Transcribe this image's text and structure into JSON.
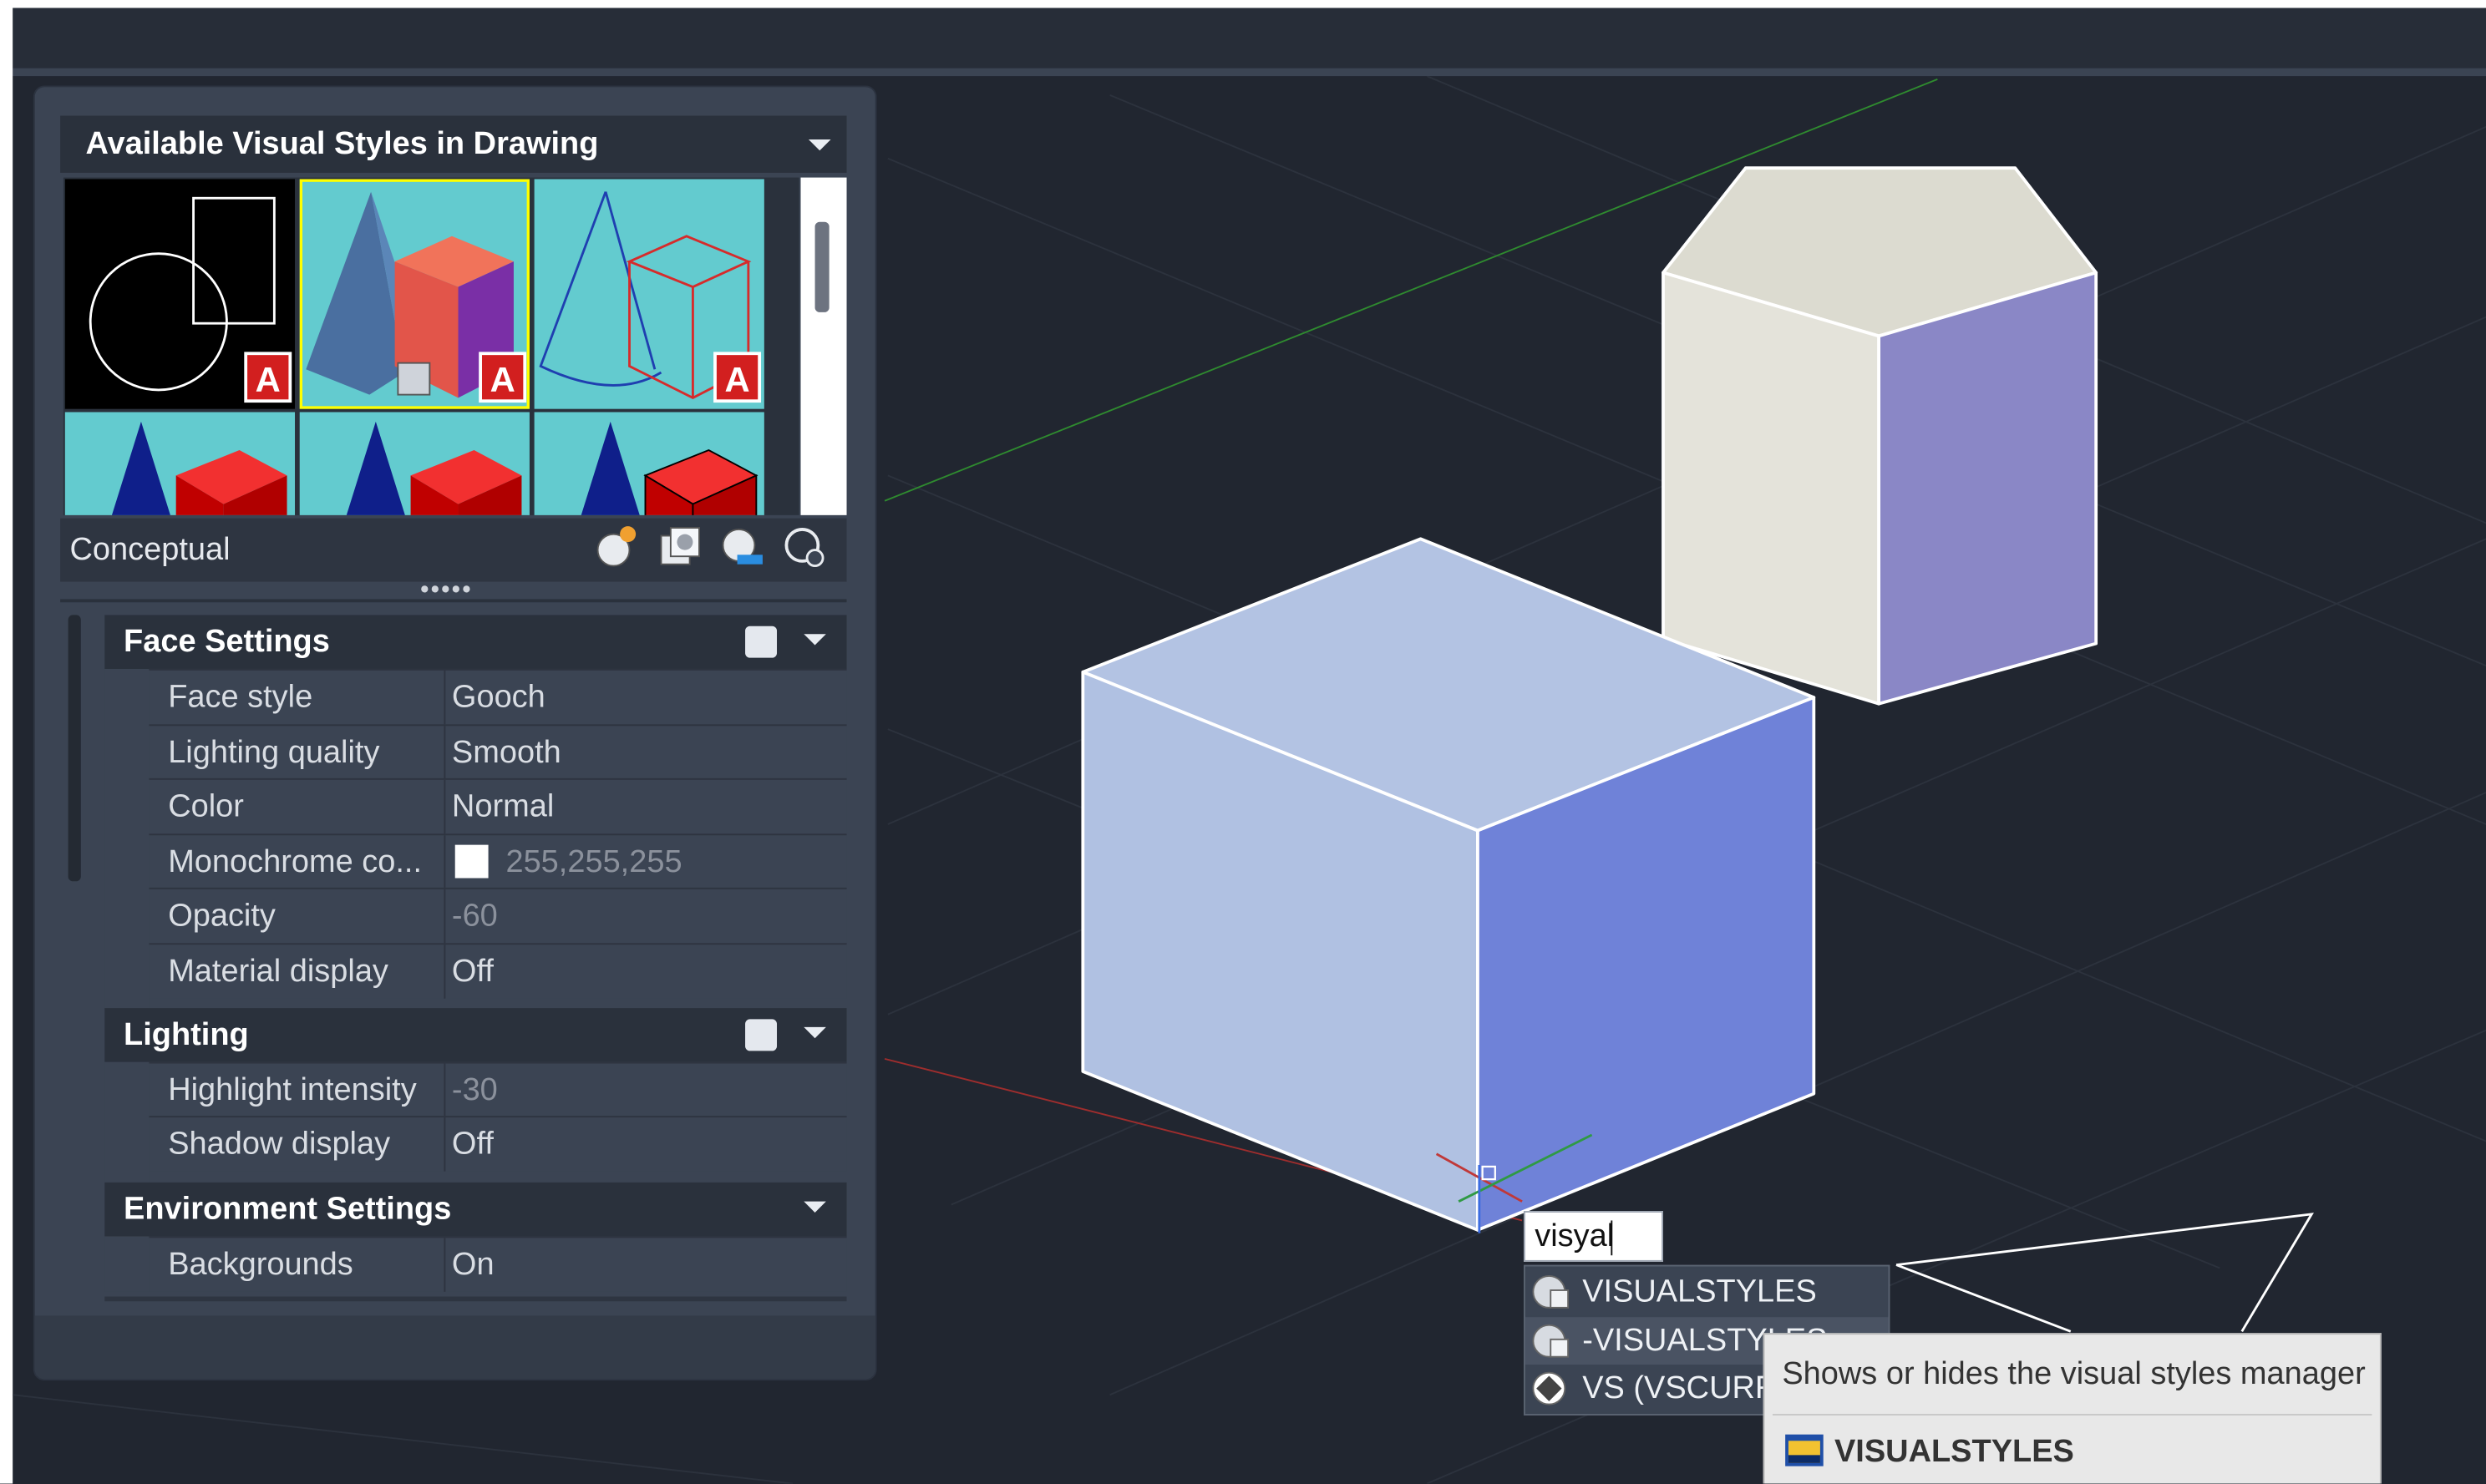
{
  "panel": {
    "styles_header": "Available Visual Styles in Drawing",
    "current_style": "Conceptual",
    "grip": "•••••",
    "tools": [
      "create-visual-style-icon",
      "apply-to-viewport-icon",
      "export-to-palette-icon",
      "delete-visual-style-icon"
    ],
    "sections": {
      "face": {
        "title": "Face Settings",
        "rows": [
          {
            "name": "Face style",
            "value": "Gooch"
          },
          {
            "name": "Lighting quality",
            "value": "Smooth"
          },
          {
            "name": "Color",
            "value": "Normal"
          },
          {
            "name": "Monochrome  co...",
            "value": "255,255,255"
          },
          {
            "name": "Opacity",
            "value": "-60"
          },
          {
            "name": "Material display",
            "value": "Off"
          }
        ]
      },
      "lighting": {
        "title": "Lighting",
        "rows": [
          {
            "name": "Highlight intensity",
            "value": "-30"
          },
          {
            "name": "Shadow display",
            "value": "Off"
          }
        ]
      },
      "environment": {
        "title": "Environment Settings",
        "rows": [
          {
            "name": "Backgrounds",
            "value": "On"
          }
        ]
      }
    }
  },
  "command": {
    "input_value": "visyal",
    "suggestions": [
      {
        "label": "VISUALSTYLES",
        "icon": "visual-styles-icon"
      },
      {
        "label": "-VISUALSTYLES",
        "icon": "visual-styles-icon"
      },
      {
        "label": "VS (VSCURRENT)",
        "icon": "vscurrent-icon"
      }
    ],
    "tooltip": {
      "description": "Shows or hides the visual styles manager",
      "command": "VISUALSTYLES"
    }
  },
  "colors": {
    "panel_bg": "#3b4453",
    "header_bg": "#2a313c",
    "viewport_bg": "#212630",
    "selection": "#ffff00",
    "thumb_bg": "#63cbcf"
  }
}
